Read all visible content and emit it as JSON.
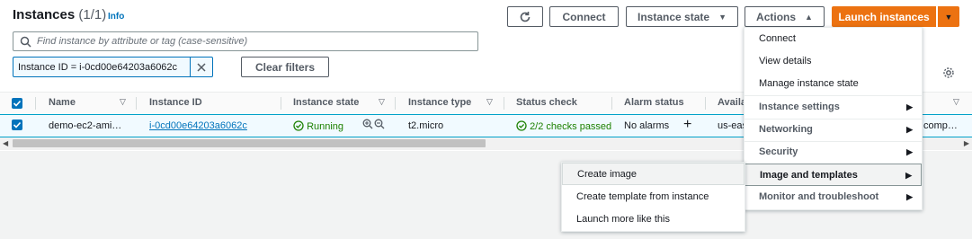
{
  "header": {
    "title": "Instances",
    "count": "(1/1)",
    "info": "Info"
  },
  "toolbar": {
    "connect": "Connect",
    "instance_state": "Instance state",
    "actions": "Actions",
    "launch": "Launch instances"
  },
  "search": {
    "placeholder": "Find instance by attribute or tag (case-sensitive)"
  },
  "filter": {
    "token": "Instance ID = i-0cd00e64203a6062c",
    "clear": "Clear filters"
  },
  "table": {
    "headers": [
      "Name",
      "Instance ID",
      "Instance state",
      "Instance type",
      "Status check",
      "Alarm status",
      "Availa"
    ],
    "row": {
      "name": "demo-ec2-ami…",
      "instance_id": "i-0cd00e64203a6062c",
      "state": "Running",
      "type": "t2.micro",
      "status": "2/2 checks passed",
      "alarm": "No alarms",
      "az": "us-eas",
      "extra": "comp…"
    }
  },
  "actions_menu": {
    "items": [
      "Connect",
      "View details",
      "Manage instance state"
    ],
    "groups": [
      "Instance settings",
      "Networking",
      "Security",
      "Image and templates",
      "Monitor and troubleshoot"
    ]
  },
  "submenu": {
    "items": [
      "Create image",
      "Create template from instance",
      "Launch more like this"
    ]
  },
  "colors": {
    "primary": "#ec7211",
    "link": "#0073bb",
    "success": "#1d8102"
  }
}
